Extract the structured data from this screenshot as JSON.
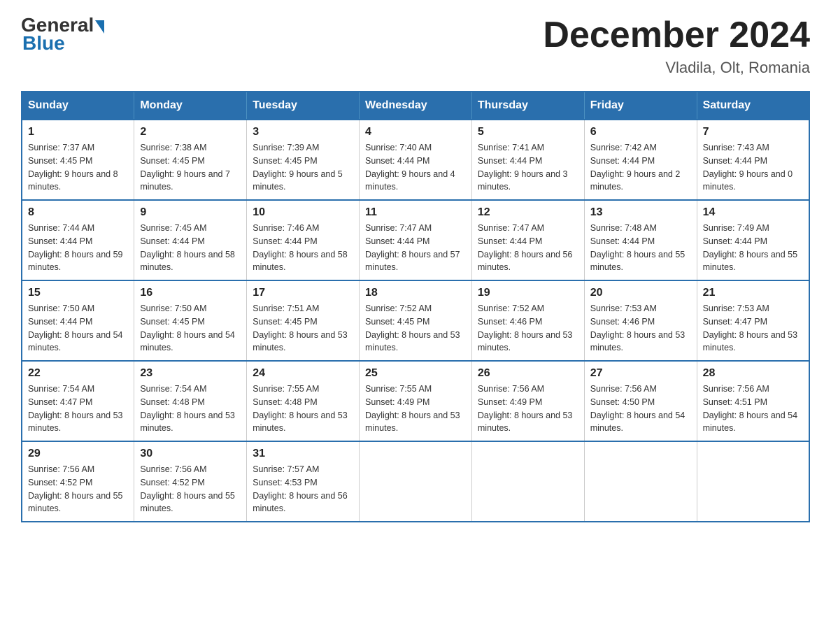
{
  "header": {
    "logo_general": "General",
    "logo_blue": "Blue",
    "title": "December 2024",
    "subtitle": "Vladila, Olt, Romania"
  },
  "days_of_week": [
    "Sunday",
    "Monday",
    "Tuesday",
    "Wednesday",
    "Thursday",
    "Friday",
    "Saturday"
  ],
  "weeks": [
    [
      {
        "day": 1,
        "sunrise": "7:37 AM",
        "sunset": "4:45 PM",
        "daylight": "9 hours and 8 minutes."
      },
      {
        "day": 2,
        "sunrise": "7:38 AM",
        "sunset": "4:45 PM",
        "daylight": "9 hours and 7 minutes."
      },
      {
        "day": 3,
        "sunrise": "7:39 AM",
        "sunset": "4:45 PM",
        "daylight": "9 hours and 5 minutes."
      },
      {
        "day": 4,
        "sunrise": "7:40 AM",
        "sunset": "4:44 PM",
        "daylight": "9 hours and 4 minutes."
      },
      {
        "day": 5,
        "sunrise": "7:41 AM",
        "sunset": "4:44 PM",
        "daylight": "9 hours and 3 minutes."
      },
      {
        "day": 6,
        "sunrise": "7:42 AM",
        "sunset": "4:44 PM",
        "daylight": "9 hours and 2 minutes."
      },
      {
        "day": 7,
        "sunrise": "7:43 AM",
        "sunset": "4:44 PM",
        "daylight": "9 hours and 0 minutes."
      }
    ],
    [
      {
        "day": 8,
        "sunrise": "7:44 AM",
        "sunset": "4:44 PM",
        "daylight": "8 hours and 59 minutes."
      },
      {
        "day": 9,
        "sunrise": "7:45 AM",
        "sunset": "4:44 PM",
        "daylight": "8 hours and 58 minutes."
      },
      {
        "day": 10,
        "sunrise": "7:46 AM",
        "sunset": "4:44 PM",
        "daylight": "8 hours and 58 minutes."
      },
      {
        "day": 11,
        "sunrise": "7:47 AM",
        "sunset": "4:44 PM",
        "daylight": "8 hours and 57 minutes."
      },
      {
        "day": 12,
        "sunrise": "7:47 AM",
        "sunset": "4:44 PM",
        "daylight": "8 hours and 56 minutes."
      },
      {
        "day": 13,
        "sunrise": "7:48 AM",
        "sunset": "4:44 PM",
        "daylight": "8 hours and 55 minutes."
      },
      {
        "day": 14,
        "sunrise": "7:49 AM",
        "sunset": "4:44 PM",
        "daylight": "8 hours and 55 minutes."
      }
    ],
    [
      {
        "day": 15,
        "sunrise": "7:50 AM",
        "sunset": "4:44 PM",
        "daylight": "8 hours and 54 minutes."
      },
      {
        "day": 16,
        "sunrise": "7:50 AM",
        "sunset": "4:45 PM",
        "daylight": "8 hours and 54 minutes."
      },
      {
        "day": 17,
        "sunrise": "7:51 AM",
        "sunset": "4:45 PM",
        "daylight": "8 hours and 53 minutes."
      },
      {
        "day": 18,
        "sunrise": "7:52 AM",
        "sunset": "4:45 PM",
        "daylight": "8 hours and 53 minutes."
      },
      {
        "day": 19,
        "sunrise": "7:52 AM",
        "sunset": "4:46 PM",
        "daylight": "8 hours and 53 minutes."
      },
      {
        "day": 20,
        "sunrise": "7:53 AM",
        "sunset": "4:46 PM",
        "daylight": "8 hours and 53 minutes."
      },
      {
        "day": 21,
        "sunrise": "7:53 AM",
        "sunset": "4:47 PM",
        "daylight": "8 hours and 53 minutes."
      }
    ],
    [
      {
        "day": 22,
        "sunrise": "7:54 AM",
        "sunset": "4:47 PM",
        "daylight": "8 hours and 53 minutes."
      },
      {
        "day": 23,
        "sunrise": "7:54 AM",
        "sunset": "4:48 PM",
        "daylight": "8 hours and 53 minutes."
      },
      {
        "day": 24,
        "sunrise": "7:55 AM",
        "sunset": "4:48 PM",
        "daylight": "8 hours and 53 minutes."
      },
      {
        "day": 25,
        "sunrise": "7:55 AM",
        "sunset": "4:49 PM",
        "daylight": "8 hours and 53 minutes."
      },
      {
        "day": 26,
        "sunrise": "7:56 AM",
        "sunset": "4:49 PM",
        "daylight": "8 hours and 53 minutes."
      },
      {
        "day": 27,
        "sunrise": "7:56 AM",
        "sunset": "4:50 PM",
        "daylight": "8 hours and 54 minutes."
      },
      {
        "day": 28,
        "sunrise": "7:56 AM",
        "sunset": "4:51 PM",
        "daylight": "8 hours and 54 minutes."
      }
    ],
    [
      {
        "day": 29,
        "sunrise": "7:56 AM",
        "sunset": "4:52 PM",
        "daylight": "8 hours and 55 minutes."
      },
      {
        "day": 30,
        "sunrise": "7:56 AM",
        "sunset": "4:52 PM",
        "daylight": "8 hours and 55 minutes."
      },
      {
        "day": 31,
        "sunrise": "7:57 AM",
        "sunset": "4:53 PM",
        "daylight": "8 hours and 56 minutes."
      },
      null,
      null,
      null,
      null
    ]
  ]
}
